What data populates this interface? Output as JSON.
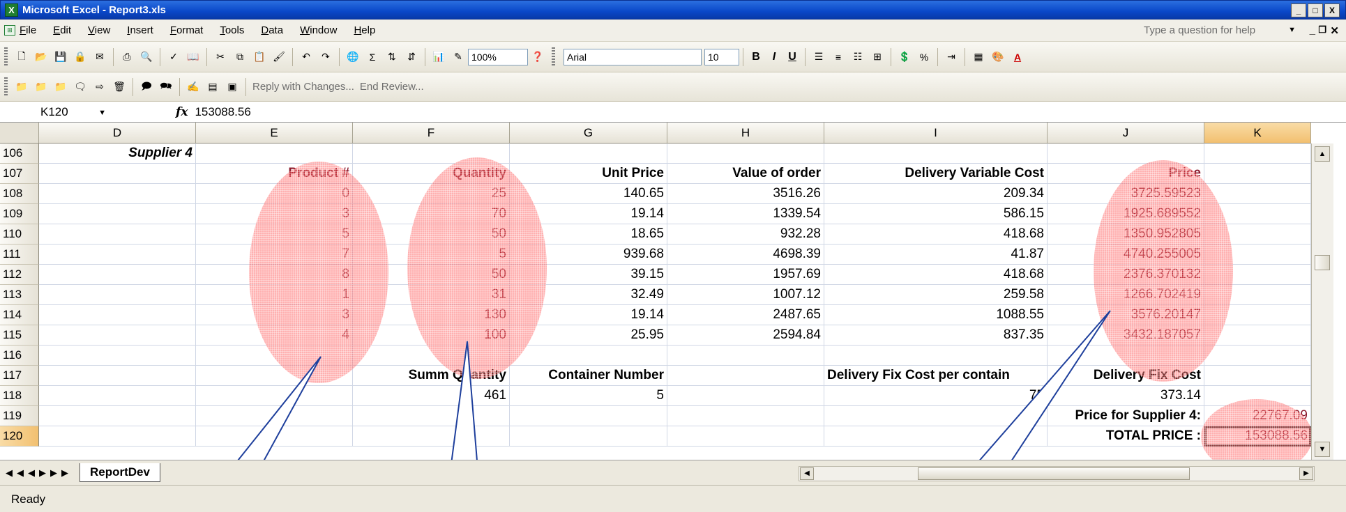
{
  "window": {
    "title": "Microsoft Excel - Report3.xls",
    "controls": [
      "_",
      "□",
      "X"
    ]
  },
  "menu": {
    "items": [
      "File",
      "Edit",
      "View",
      "Insert",
      "Format",
      "Tools",
      "Data",
      "Window",
      "Help"
    ],
    "help_placeholder": "Type a question for help"
  },
  "toolbar": {
    "zoom": "100%",
    "font_name": "Arial",
    "font_size": "10",
    "bold": "B",
    "italic": "I",
    "underline": "U",
    "percent": "%",
    "sigma": "Σ",
    "reply_with_changes": "Reply with Changes...",
    "end_review": "End Review..."
  },
  "formula_bar": {
    "name_box": "K120",
    "fx": "fx",
    "value": "153088.56"
  },
  "columns": [
    "D",
    "E",
    "F",
    "G",
    "H",
    "I",
    "J",
    "K"
  ],
  "active_column": "K",
  "active_row": "120",
  "rows": [
    {
      "n": "106",
      "D": "Supplier 4"
    },
    {
      "n": "107",
      "E": "Product #",
      "F": "Quantity",
      "G": "Unit Price",
      "H": "Value of order",
      "I": "Delivery Variable Cost",
      "J": "Price"
    },
    {
      "n": "108",
      "E": "0",
      "F": "25",
      "G": "140.65",
      "H": "3516.26",
      "I": "209.34",
      "J": "3725.59523"
    },
    {
      "n": "109",
      "E": "3",
      "F": "70",
      "G": "19.14",
      "H": "1339.54",
      "I": "586.15",
      "J": "1925.689552"
    },
    {
      "n": "110",
      "E": "5",
      "F": "50",
      "G": "18.65",
      "H": "932.28",
      "I": "418.68",
      "J": "1350.952805"
    },
    {
      "n": "111",
      "E": "7",
      "F": "5",
      "G": "939.68",
      "H": "4698.39",
      "I": "41.87",
      "J": "4740.255005"
    },
    {
      "n": "112",
      "E": "8",
      "F": "50",
      "G": "39.15",
      "H": "1957.69",
      "I": "418.68",
      "J": "2376.370132"
    },
    {
      "n": "113",
      "E": "1",
      "F": "31",
      "G": "32.49",
      "H": "1007.12",
      "I": "259.58",
      "J": "1266.702419"
    },
    {
      "n": "114",
      "E": "3",
      "F": "130",
      "G": "19.14",
      "H": "2487.65",
      "I": "1088.55",
      "J": "3576.20147"
    },
    {
      "n": "115",
      "E": "4",
      "F": "100",
      "G": "25.95",
      "H": "2594.84",
      "I": "837.35",
      "J": "3432.187057"
    },
    {
      "n": "116"
    },
    {
      "n": "117",
      "F": "Summ Quantity",
      "G": "Container Number",
      "I": "Delivery Fix Cost per contain",
      "J": "Delivery Fix Cost"
    },
    {
      "n": "118",
      "F": "461",
      "G": "5",
      "I": "75",
      "J": "373.14"
    },
    {
      "n": "119",
      "J": "Price for Supplier 4:",
      "K": "22767.09"
    },
    {
      "n": "120",
      "J": "TOTAL PRICE :",
      "K": "153088.56"
    }
  ],
  "sheet_tab": "ReportDev",
  "status": "Ready",
  "colors": {
    "title_bar": "#0a47c8",
    "highlight": "#ff5050",
    "highlight_text": "#8c1c2e",
    "active_header": "#f2c070"
  }
}
